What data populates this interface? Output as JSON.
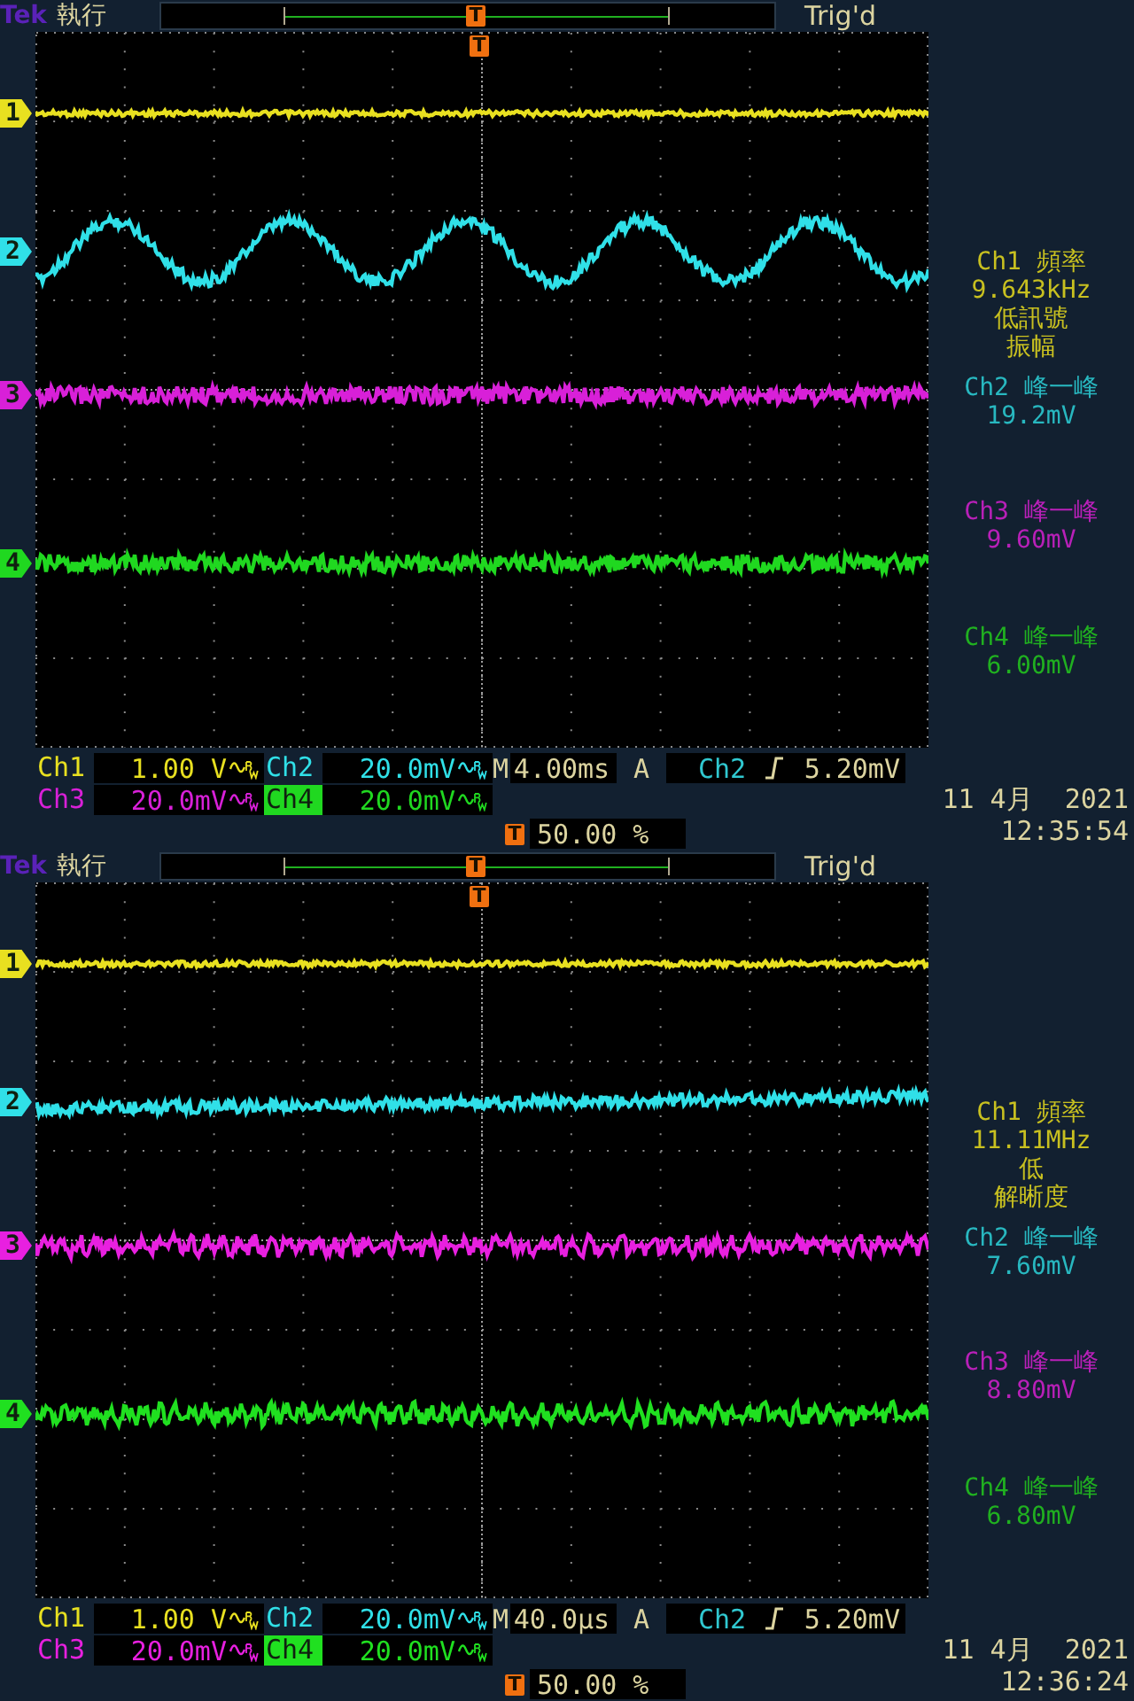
{
  "screens": [
    {
      "brand": "Tek",
      "run_state": "執行",
      "trigger_status": "Trig'd",
      "record_marker": "T",
      "graticule_marker": "T",
      "channels": [
        {
          "marker": "1",
          "color": "#e8e020",
          "kind": "flat"
        },
        {
          "marker": "2",
          "color": "#30e0e8",
          "kind": "sine"
        },
        {
          "marker": "3",
          "color": "#d820d8",
          "kind": "noisy"
        },
        {
          "marker": "4",
          "color": "#20d820",
          "kind": "noisy"
        }
      ],
      "scales": [
        {
          "label": "Ch1",
          "value": "1.00 V",
          "selected": false,
          "bandwidth_limited": true
        },
        {
          "label": "Ch2",
          "value": "20.0mV",
          "selected": false,
          "bandwidth_limited": true
        },
        {
          "label": "Ch3",
          "value": "20.0mV",
          "selected": false,
          "bandwidth_limited": true
        },
        {
          "label": "Ch4",
          "value": "20.0mV",
          "selected": true,
          "bandwidth_limited": true
        }
      ],
      "horizontal": {
        "label": "M",
        "value": "4.00ms"
      },
      "trigger": {
        "label": "A",
        "source": "Ch2",
        "level": "5.20mV"
      },
      "trigger_position": {
        "marker": "T",
        "value": "50.00 %"
      },
      "measurements": [
        {
          "color": "#c8c020",
          "lines": [
            "Ch1 頻率",
            "9.643kHz",
            "低訊號",
            "振幅"
          ]
        },
        {
          "color": "#28b8c0",
          "lines": [
            "Ch2 峰一峰",
            "19.2mV"
          ]
        },
        {
          "color": "#b820b8",
          "lines": [
            "Ch3 峰一峰",
            "9.60mV"
          ]
        },
        {
          "color": "#20b020",
          "lines": [
            "Ch4 峰一峰",
            "6.00mV"
          ]
        }
      ],
      "date": "11 4月  2021",
      "time": "12:35:54"
    },
    {
      "brand": "Tek",
      "run_state": "執行",
      "trigger_status": "Trig'd",
      "record_marker": "T",
      "graticule_marker": "T",
      "channels": [
        {
          "marker": "1",
          "color": "#e8e020",
          "kind": "flat"
        },
        {
          "marker": "2",
          "color": "#30e0e8",
          "kind": "drift"
        },
        {
          "marker": "3",
          "color": "#e820e0",
          "kind": "ripple"
        },
        {
          "marker": "4",
          "color": "#20e020",
          "kind": "ripple"
        }
      ],
      "scales": [
        {
          "label": "Ch1",
          "value": "1.00 V",
          "selected": false,
          "bandwidth_limited": true
        },
        {
          "label": "Ch2",
          "value": "20.0mV",
          "selected": false,
          "bandwidth_limited": true
        },
        {
          "label": "Ch3",
          "value": "20.0mV",
          "selected": false,
          "bandwidth_limited": true
        },
        {
          "label": "Ch4",
          "value": "20.0mV",
          "selected": true,
          "bandwidth_limited": true
        }
      ],
      "horizontal": {
        "label": "M",
        "value": "40.0µs"
      },
      "trigger": {
        "label": "A",
        "source": "Ch2",
        "level": "5.20mV"
      },
      "trigger_position": {
        "marker": "T",
        "value": "50.00 %"
      },
      "measurements": [
        {
          "color": "#c8c020",
          "lines": [
            "Ch1 頻率",
            "11.11MHz",
            "低",
            "解晰度"
          ]
        },
        {
          "color": "#28b8c0",
          "lines": [
            "Ch2 峰一峰",
            "7.60mV"
          ]
        },
        {
          "color": "#b820b8",
          "lines": [
            "Ch3 峰一峰",
            "8.80mV"
          ]
        },
        {
          "color": "#20b020",
          "lines": [
            "Ch4 峰一峰",
            "6.80mV"
          ]
        }
      ],
      "date": "11 4月  2021",
      "time": "12:36:24"
    }
  ]
}
